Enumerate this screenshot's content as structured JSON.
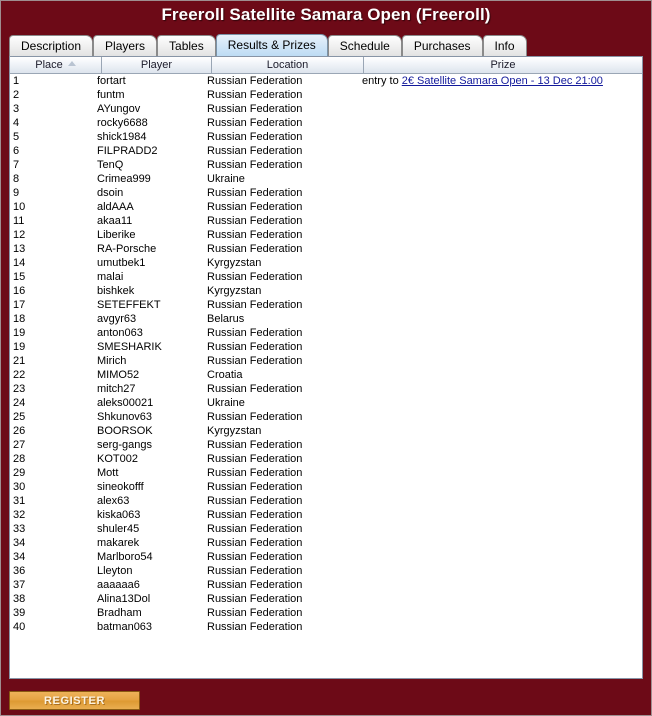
{
  "window": {
    "title": "Freeroll Satellite Samara Open (Freeroll)",
    "frame_color": "#6d0a17",
    "title_color": "#ffffff"
  },
  "tabs": [
    {
      "label": "Description",
      "active": false
    },
    {
      "label": "Players",
      "active": false
    },
    {
      "label": "Tables",
      "active": false
    },
    {
      "label": "Results & Prizes",
      "active": true
    },
    {
      "label": "Schedule",
      "active": false
    },
    {
      "label": "Purchases",
      "active": false
    },
    {
      "label": "Info",
      "active": false
    }
  ],
  "table": {
    "columns": [
      {
        "key": "place",
        "label": "Place",
        "sorted": "asc"
      },
      {
        "key": "player",
        "label": "Player",
        "sorted": ""
      },
      {
        "key": "location",
        "label": "Location",
        "sorted": ""
      },
      {
        "key": "prize",
        "label": "Prize",
        "sorted": ""
      }
    ],
    "prize_prefix": "entry to ",
    "prize_link": "2€ Satellite Samara Open - 13 Dec 21:00",
    "rows": [
      {
        "place": "1",
        "player": "fortart",
        "location": "Russian Federation",
        "prize": true
      },
      {
        "place": "2",
        "player": "funtm",
        "location": "Russian Federation",
        "prize": false
      },
      {
        "place": "3",
        "player": "AYungov",
        "location": "Russian Federation",
        "prize": false
      },
      {
        "place": "4",
        "player": "rocky6688",
        "location": "Russian Federation",
        "prize": false
      },
      {
        "place": "5",
        "player": "shick1984",
        "location": "Russian Federation",
        "prize": false
      },
      {
        "place": "6",
        "player": "FILPRADD2",
        "location": "Russian Federation",
        "prize": false
      },
      {
        "place": "7",
        "player": "TenQ",
        "location": "Russian Federation",
        "prize": false
      },
      {
        "place": "8",
        "player": "Crimea999",
        "location": "Ukraine",
        "prize": false
      },
      {
        "place": "9",
        "player": "dsoin",
        "location": "Russian Federation",
        "prize": false
      },
      {
        "place": "10",
        "player": "aldAAA",
        "location": "Russian Federation",
        "prize": false
      },
      {
        "place": "11",
        "player": "akaa11",
        "location": "Russian Federation",
        "prize": false
      },
      {
        "place": "12",
        "player": "Liberike",
        "location": "Russian Federation",
        "prize": false
      },
      {
        "place": "13",
        "player": "RA-Porsche",
        "location": "Russian Federation",
        "prize": false
      },
      {
        "place": "14",
        "player": "umutbek1",
        "location": "Kyrgyzstan",
        "prize": false
      },
      {
        "place": "15",
        "player": "malai",
        "location": "Russian Federation",
        "prize": false
      },
      {
        "place": "16",
        "player": "bishkek",
        "location": "Kyrgyzstan",
        "prize": false
      },
      {
        "place": "17",
        "player": "SETEFFEKT",
        "location": "Russian Federation",
        "prize": false
      },
      {
        "place": "18",
        "player": "avgyr63",
        "location": "Belarus",
        "prize": false
      },
      {
        "place": "19",
        "player": "anton063",
        "location": "Russian Federation",
        "prize": false
      },
      {
        "place": "19",
        "player": "SMESHARIK",
        "location": "Russian Federation",
        "prize": false
      },
      {
        "place": "21",
        "player": "Mirich",
        "location": "Russian Federation",
        "prize": false
      },
      {
        "place": "22",
        "player": "MIMO52",
        "location": "Croatia",
        "prize": false
      },
      {
        "place": "23",
        "player": "mitch27",
        "location": "Russian Federation",
        "prize": false
      },
      {
        "place": "24",
        "player": "aleks00021",
        "location": "Ukraine",
        "prize": false
      },
      {
        "place": "25",
        "player": "Shkunov63",
        "location": "Russian Federation",
        "prize": false
      },
      {
        "place": "26",
        "player": "BOORSOK",
        "location": "Kyrgyzstan",
        "prize": false
      },
      {
        "place": "27",
        "player": "serg-gangs",
        "location": "Russian Federation",
        "prize": false
      },
      {
        "place": "28",
        "player": "KOT002",
        "location": "Russian Federation",
        "prize": false
      },
      {
        "place": "29",
        "player": "Mott",
        "location": "Russian Federation",
        "prize": false
      },
      {
        "place": "30",
        "player": "sineokofff",
        "location": "Russian Federation",
        "prize": false
      },
      {
        "place": "31",
        "player": "alex63",
        "location": "Russian Federation",
        "prize": false
      },
      {
        "place": "32",
        "player": "kiska063",
        "location": "Russian Federation",
        "prize": false
      },
      {
        "place": "33",
        "player": "shuler45",
        "location": "Russian Federation",
        "prize": false
      },
      {
        "place": "34",
        "player": "makarek",
        "location": "Russian Federation",
        "prize": false
      },
      {
        "place": "34",
        "player": "Marlboro54",
        "location": "Russian Federation",
        "prize": false
      },
      {
        "place": "36",
        "player": "Lleyton",
        "location": "Russian Federation",
        "prize": false
      },
      {
        "place": "37",
        "player": "aaaaaa6",
        "location": "Russian Federation",
        "prize": false
      },
      {
        "place": "38",
        "player": "Alina13Dol",
        "location": "Russian Federation",
        "prize": false
      },
      {
        "place": "39",
        "player": "Bradham",
        "location": "Russian Federation",
        "prize": false
      },
      {
        "place": "40",
        "player": "batman063",
        "location": "Russian Federation",
        "prize": false
      }
    ]
  },
  "footer": {
    "register_label": "REGISTER",
    "register_color": "#e5a342"
  }
}
